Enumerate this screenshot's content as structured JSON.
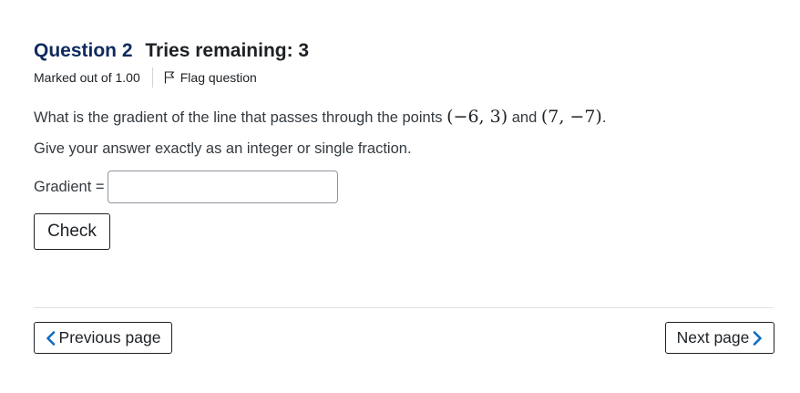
{
  "question": {
    "number_label": "Question 2",
    "tries_label": "Tries remaining: 3",
    "marked_out_of": "Marked out of 1.00",
    "flag_label": "Flag question",
    "text_before": "What is the gradient of the line that passes through the points ",
    "point1": "(−6, 3)",
    "text_and": " and ",
    "point2": "(7, −7)",
    "text_end": ".",
    "prompt": "Give your answer exactly as an integer or single fraction.",
    "answer_label": "Gradient =",
    "answer_value": "",
    "check_label": "Check"
  },
  "navigation": {
    "previous_label": "Previous page",
    "next_label": "Next page"
  },
  "icons": {
    "flag": "flag-icon",
    "previous": "chevron-left-icon",
    "next": "chevron-right-icon"
  },
  "colors": {
    "accent": "#0f6cbf",
    "heading": "#0f2a5e",
    "text": "#1d2125"
  }
}
